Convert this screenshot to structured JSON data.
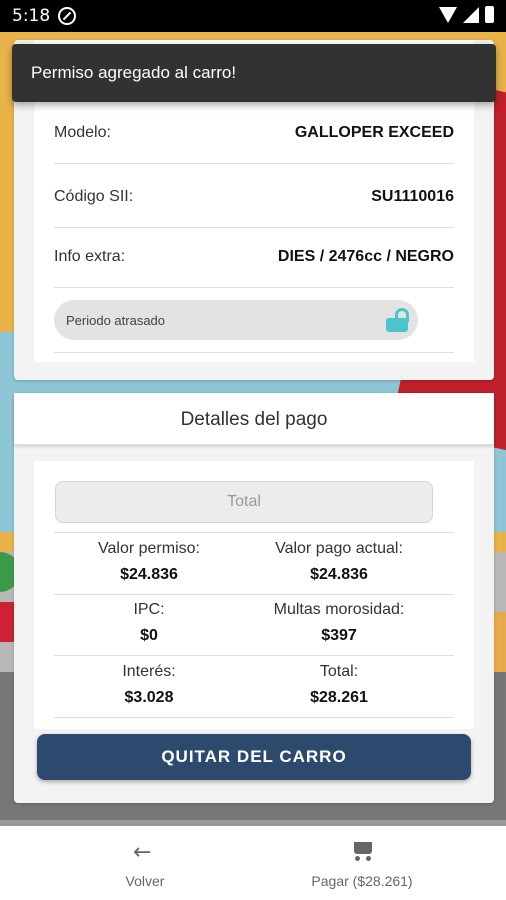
{
  "status_bar": {
    "time": "5:18"
  },
  "toast": {
    "message": "Permiso agregado al carro!"
  },
  "vehicle": {
    "rows": [
      {
        "label": "Modelo:",
        "value": "GALLOPER EXCEED"
      },
      {
        "label": "Código SII:",
        "value": "SU1110016"
      },
      {
        "label": "Info extra:",
        "value": "DIES / 2476cc / NEGRO"
      }
    ],
    "periodo_atrasado_label": "Periodo atrasado"
  },
  "payment": {
    "title": "Detalles del pago",
    "total_button": "Total",
    "items": [
      {
        "label": "Valor permiso:",
        "value": "$24.836"
      },
      {
        "label": "Valor pago actual:",
        "value": "$24.836"
      },
      {
        "label": "IPC:",
        "value": "$0"
      },
      {
        "label": "Multas morosidad:",
        "value": "$397"
      },
      {
        "label": "Interés:",
        "value": "$3.028"
      },
      {
        "label": "Total:",
        "value": "$28.261"
      }
    ],
    "remove_button": "QUITAR DEL CARRO"
  },
  "bottom_nav": {
    "back_label": "Volver",
    "pay_label": "Pagar ($28.261)"
  },
  "colors": {
    "primary_button": "#2d4a6e",
    "lock_accent": "#4cc4cc",
    "toast_bg": "#323232"
  }
}
